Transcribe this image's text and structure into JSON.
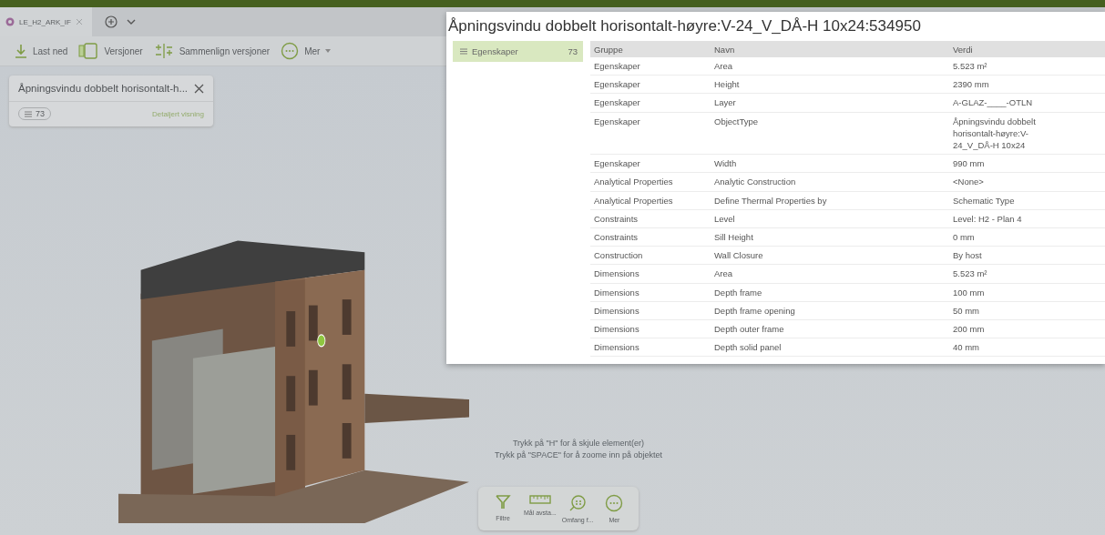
{
  "file_tab": {
    "label": "LE_H2_ARK_IF"
  },
  "toolbar": [
    {
      "kind": "download",
      "label": "Last ned"
    },
    {
      "kind": "versions",
      "label": "Versjoner"
    },
    {
      "kind": "compare",
      "label": "Sammenlign versjoner"
    },
    {
      "kind": "more",
      "label": "Mer",
      "dropdown": true
    }
  ],
  "selection_card": {
    "title": "Åpningsvindu dobbelt horisontalt-h...",
    "count": "73",
    "link": "Detaljert visning"
  },
  "hints": [
    "Trykk på \"H\" for å skjule element(er)",
    "Trykk på \"SPACE\" for å zoome inn på objektet"
  ],
  "bottom_tools": [
    {
      "kind": "filter",
      "label": "Filtre"
    },
    {
      "kind": "ruler",
      "label": "Mål avsta..."
    },
    {
      "kind": "scope",
      "label": "Omfang f..."
    },
    {
      "kind": "more",
      "label": "Mer"
    }
  ],
  "dialog": {
    "title": "Åpningsvindu dobbelt horisontalt-høyre:V-24_V_DÅ-H 10x24:534950",
    "sidebar": [
      {
        "label": "Egenskaper",
        "count": "73",
        "selected": true
      }
    ],
    "columns": [
      "Gruppe",
      "Navn",
      "Verdi"
    ],
    "rows": [
      [
        "Egenskaper",
        "Area",
        "5.523 m²"
      ],
      [
        "Egenskaper",
        "Height",
        "2390 mm"
      ],
      [
        "Egenskaper",
        "Layer",
        "A-GLAZ-____-OTLN"
      ],
      [
        "Egenskaper",
        "ObjectType",
        "Åpningsvindu dobbelt horisontalt-høyre:V-24_V_DÅ-H 10x24"
      ],
      [
        "Egenskaper",
        "Width",
        "990 mm"
      ],
      [
        "Analytical Properties",
        "Analytic Construction",
        "<None>"
      ],
      [
        "Analytical Properties",
        "Define Thermal Properties by",
        "Schematic Type"
      ],
      [
        "Constraints",
        "Level",
        "Level: H2 - Plan 4"
      ],
      [
        "Constraints",
        "Sill Height",
        "0 mm"
      ],
      [
        "Construction",
        "Wall Closure",
        "By host"
      ],
      [
        "Dimensions",
        "Area",
        "5.523 m²"
      ],
      [
        "Dimensions",
        "Depth frame",
        "100 mm"
      ],
      [
        "Dimensions",
        "Depth frame opening",
        "50 mm"
      ],
      [
        "Dimensions",
        "Depth outer frame",
        "200 mm"
      ],
      [
        "Dimensions",
        "Depth solid panel",
        "40 mm"
      ]
    ]
  }
}
